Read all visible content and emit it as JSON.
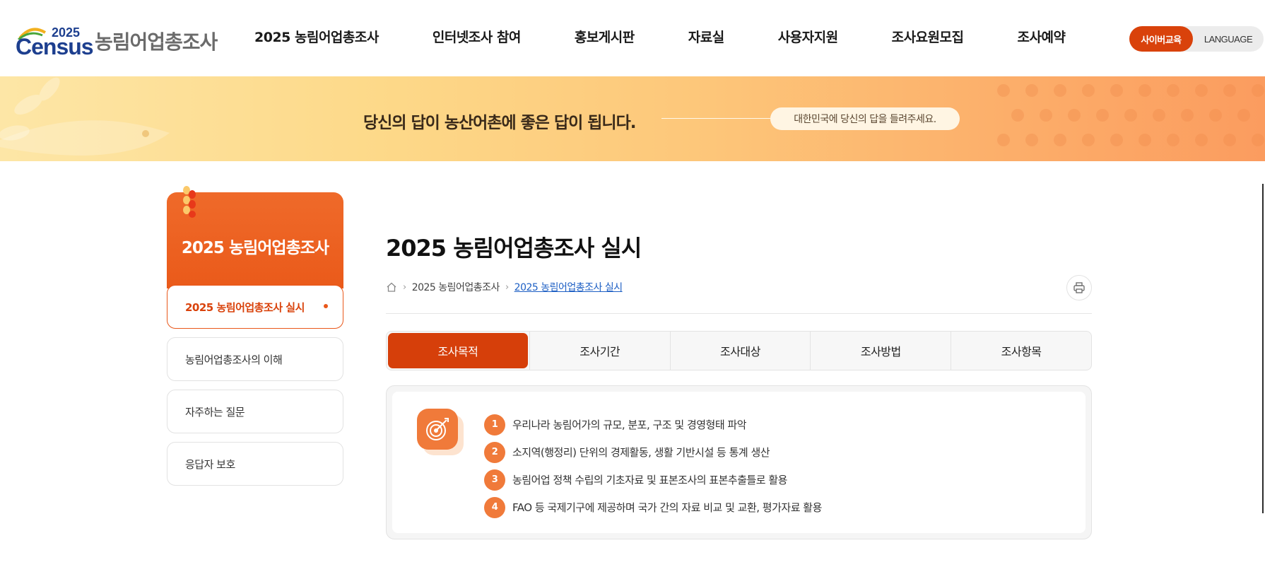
{
  "header": {
    "logo_year": "2025",
    "logo_word": "Census",
    "logo_title": "농림어업총조사",
    "nav": [
      "2025 농림어업총조사",
      "인터넷조사 참여",
      "홍보게시판",
      "자료실",
      "사용자지원",
      "조사요원모집",
      "조사예약"
    ],
    "util_cyber": "사이버교육",
    "util_language": "LANGUAGE",
    "accent_color": "#d9420b"
  },
  "banner": {
    "title": "당신의 답이 농산어촌에 좋은 답이 됩니다.",
    "pill": "대한민국에 당신의 답을 들려주세요."
  },
  "sidebar": {
    "title": "2025 농림어업총조사",
    "items": [
      {
        "label": "2025 농림어업총조사 실시",
        "active": true
      },
      {
        "label": "농림어업총조사의 이해",
        "active": false
      },
      {
        "label": "자주하는 질문",
        "active": false
      },
      {
        "label": "응답자 보호",
        "active": false
      }
    ]
  },
  "main": {
    "title": "2025 농림어업총조사 실시",
    "breadcrumb": [
      "2025 농림어업총조사",
      "2025 농림어업총조사 실시"
    ],
    "tabs": [
      {
        "label": "조사목적",
        "active": true
      },
      {
        "label": "조사기간",
        "active": false
      },
      {
        "label": "조사대상",
        "active": false
      },
      {
        "label": "조사방법",
        "active": false
      },
      {
        "label": "조사항목",
        "active": false
      }
    ],
    "purposes": [
      {
        "num": "1",
        "text": "우리나라 농림어가의 규모, 분포, 구조 및 경영형태 파악"
      },
      {
        "num": "2",
        "text": "소지역(행정리) 단위의 경제활동, 생활 기반시설 등 통계 생산"
      },
      {
        "num": "3",
        "text": "농림어업 정책 수립의 기초자료 및 표본조사의 표본추출틀로 활용"
      },
      {
        "num": "4",
        "text": "FAO 등 국제기구에 제공하며 국가 간의 자료 비교 및 교환, 평가자료 활용"
      }
    ]
  }
}
